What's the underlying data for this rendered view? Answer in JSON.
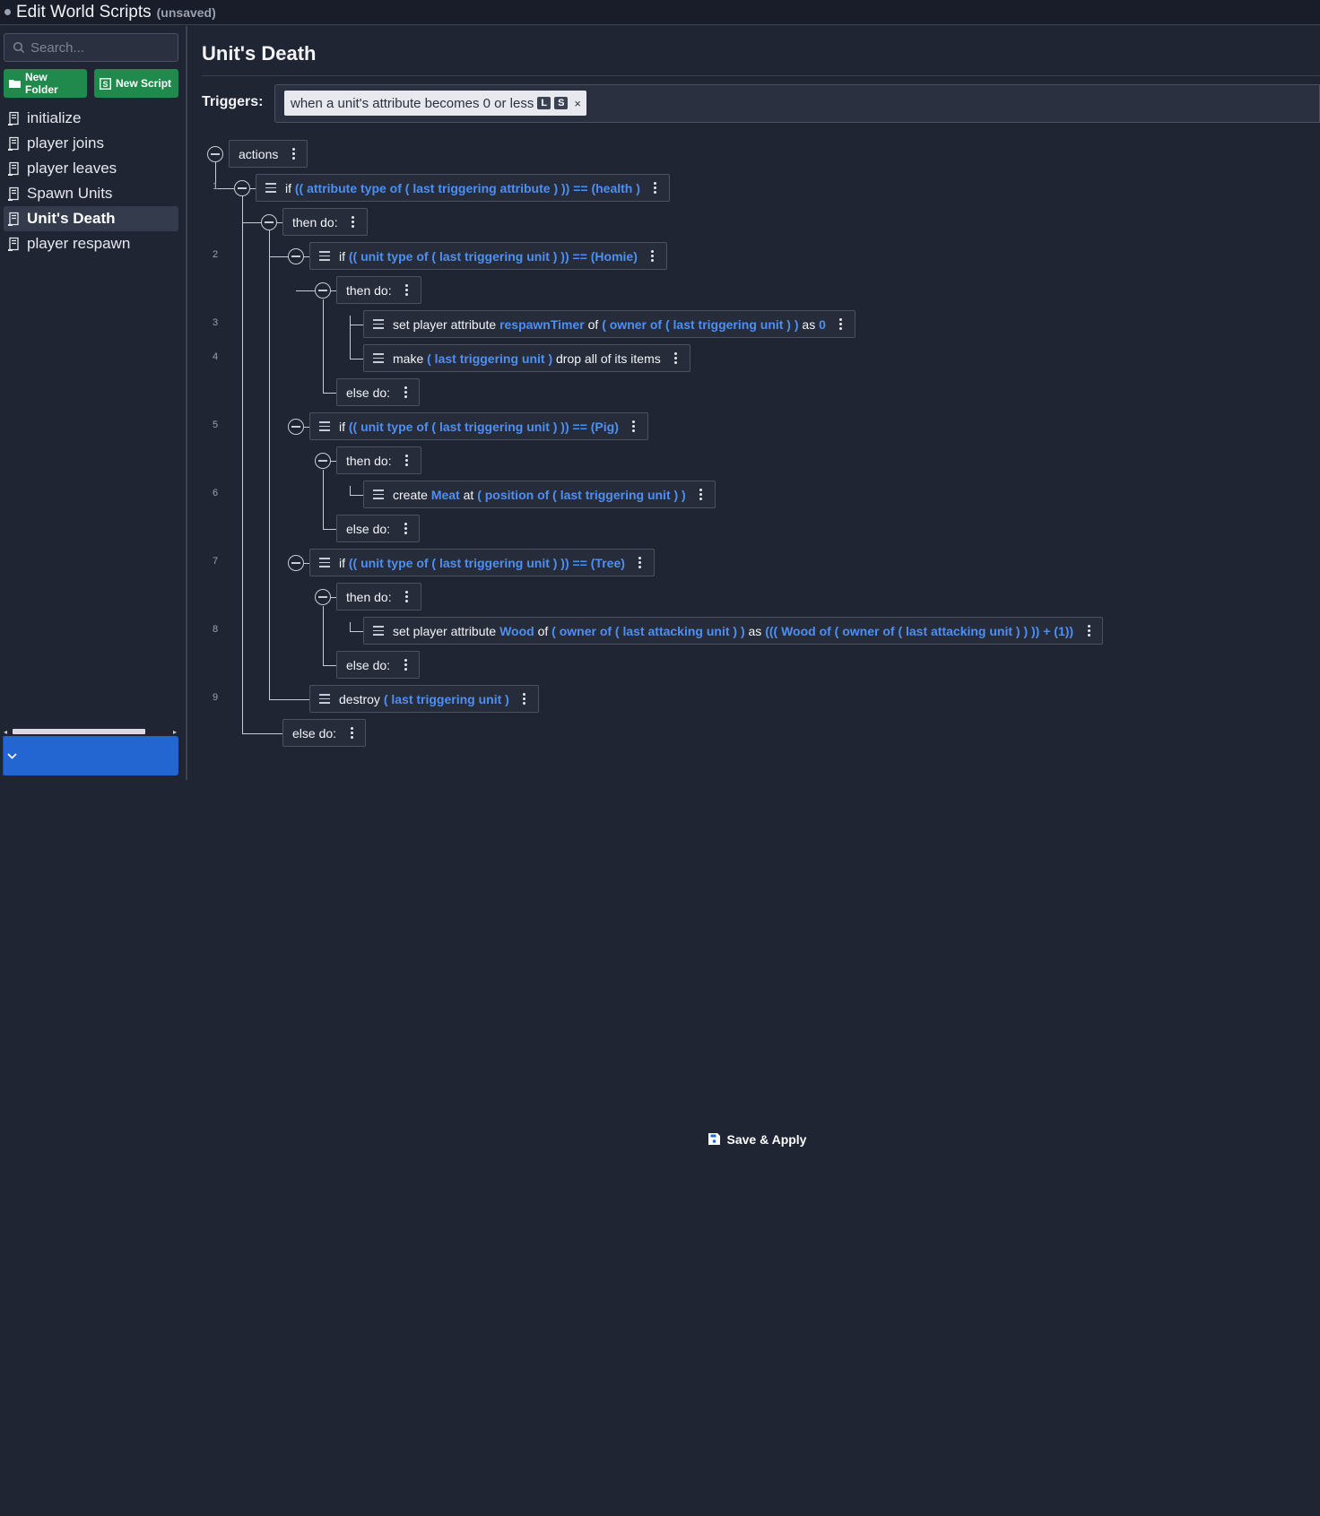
{
  "window": {
    "title": "Edit World Scripts",
    "unsaved": "(unsaved)"
  },
  "sidebar": {
    "search_placeholder": "Search...",
    "new_folder": "New Folder",
    "new_script": "New Script",
    "scripts": [
      {
        "label": "initialize"
      },
      {
        "label": "player joins"
      },
      {
        "label": "player leaves"
      },
      {
        "label": "Spawn Units"
      },
      {
        "label": "Unit's Death",
        "active": true
      },
      {
        "label": "player respawn"
      }
    ],
    "save": "Save & Apply"
  },
  "main": {
    "script_title": "Unit's Death",
    "triggers_label": "Triggers:",
    "trigger": {
      "text": "when a unit's attribute becomes 0 or less",
      "badge_l": "L",
      "badge_s": "S",
      "remove": "×"
    }
  },
  "tree": {
    "actions": "actions",
    "then_do": "then do:",
    "else_do": "else do:",
    "line_numbers": [
      "1",
      "2",
      "3",
      "4",
      "5",
      "6",
      "7",
      "8",
      "9"
    ],
    "lines": [
      [
        [
          "if ",
          ""
        ],
        [
          "(( attribute type of ( last triggering attribute ) )) == (health )",
          "hl"
        ]
      ],
      [
        [
          "if ",
          ""
        ],
        [
          "(( unit type of ( last triggering unit ) )) == (Homie)",
          "hl"
        ]
      ],
      [
        [
          "set player attribute ",
          ""
        ],
        [
          "respawnTimer",
          "hl"
        ],
        [
          " of ",
          ""
        ],
        [
          "( owner of ( last triggering unit ) )",
          "hl"
        ],
        [
          " as ",
          ""
        ],
        [
          "0",
          "hl"
        ]
      ],
      [
        [
          "make ",
          ""
        ],
        [
          "( last triggering unit )",
          "hl"
        ],
        [
          " drop all of its items",
          ""
        ]
      ],
      [
        [
          "if ",
          ""
        ],
        [
          "(( unit type of ( last triggering unit ) )) == (Pig)",
          "hl"
        ]
      ],
      [
        [
          "create ",
          ""
        ],
        [
          "Meat",
          "hl"
        ],
        [
          " at ",
          ""
        ],
        [
          "( position of ( last triggering unit ) )",
          "hl"
        ]
      ],
      [
        [
          "if ",
          ""
        ],
        [
          "(( unit type of ( last triggering unit ) )) == (Tree)",
          "hl"
        ]
      ],
      [
        [
          "set player attribute ",
          ""
        ],
        [
          "Wood",
          "hl"
        ],
        [
          " of ",
          ""
        ],
        [
          "( owner of ( last attacking unit ) )",
          "hl"
        ],
        [
          " as ",
          ""
        ],
        [
          "((( Wood of ( owner of ( last attacking unit ) ) )) + (1))",
          "hl"
        ]
      ],
      [
        [
          "destroy ",
          ""
        ],
        [
          "( last triggering unit )",
          "hl"
        ]
      ]
    ]
  }
}
